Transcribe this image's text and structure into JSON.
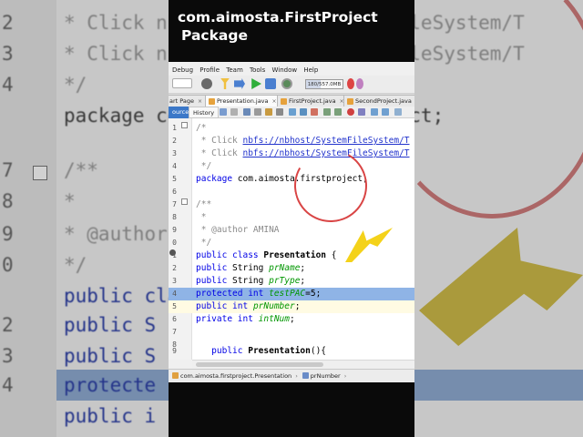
{
  "caption": {
    "line1": "com.aimosta.FirstProject",
    "line2": "Package"
  },
  "background": {
    "lines": [
      {
        "num": "2",
        "text": " * Click nbfs://nbhost/SystemFileSystem/T",
        "style": "cmt"
      },
      {
        "num": "3",
        "text": " * Click nbfs://nbhost/SystemFileSystem/T",
        "style": "cmt"
      },
      {
        "num": "4",
        "text": " */",
        "style": "cmt"
      },
      {
        "num": "",
        "text": "package com.aimosta.firstproject;",
        "style": "plain"
      },
      {
        "num": "7",
        "text": "/**",
        "style": "cmt"
      },
      {
        "num": "8",
        "text": " *",
        "style": "cmt"
      },
      {
        "num": "9",
        "text": " * @author",
        "style": "cmt"
      },
      {
        "num": "0",
        "text": " */",
        "style": "cmt"
      },
      {
        "num": "",
        "text": "public class P",
        "style": "kw"
      },
      {
        "num": "2",
        "text": "public S",
        "style": "kw"
      },
      {
        "num": "3",
        "text": "public S",
        "style": "kw"
      },
      {
        "num": "4",
        "text": "protecte",
        "style": "kw"
      },
      {
        "num": "",
        "text": "public i",
        "style": "kw"
      }
    ]
  },
  "menu": {
    "items": [
      "Debug",
      "Profile",
      "Team",
      "Tools",
      "Window",
      "Help"
    ]
  },
  "toolbar": {
    "memory": "180/557.0MB"
  },
  "tabs": [
    {
      "label": "art Page",
      "close": "×"
    },
    {
      "label": "Presentation.java",
      "close": "×"
    },
    {
      "label": "FirstProject.java",
      "close": "×"
    },
    {
      "label": "SecondProject.java",
      "close": "×"
    }
  ],
  "editor_tabs": {
    "source": "ource",
    "history": "History"
  },
  "code": [
    {
      "n": "1",
      "parts": [
        {
          "t": "/*",
          "c": "cm"
        }
      ]
    },
    {
      "n": "2",
      "parts": [
        {
          "t": " * Click ",
          "c": "cm"
        },
        {
          "t": "nbfs://nbhost/SystemFileSystem/T",
          "c": "lnk"
        }
      ]
    },
    {
      "n": "3",
      "parts": [
        {
          "t": " * Click ",
          "c": "cm"
        },
        {
          "t": "nbfs://nbhost/SystemFileSystem/T",
          "c": "lnk"
        }
      ]
    },
    {
      "n": "4",
      "parts": [
        {
          "t": " */",
          "c": "cm"
        }
      ]
    },
    {
      "n": "5",
      "parts": [
        {
          "t": "package",
          "c": "kw"
        },
        {
          "t": " com.aimosta.firstproject;",
          "c": ""
        }
      ]
    },
    {
      "n": "6",
      "parts": []
    },
    {
      "n": "7",
      "parts": [
        {
          "t": "/**",
          "c": "cm"
        }
      ]
    },
    {
      "n": "8",
      "parts": [
        {
          "t": " *",
          "c": "cm"
        }
      ]
    },
    {
      "n": "9",
      "parts": [
        {
          "t": " * @author AMINA",
          "c": "cm"
        }
      ]
    },
    {
      "n": "0",
      "parts": [
        {
          "t": " */",
          "c": "cm"
        }
      ]
    },
    {
      "n": "1",
      "parts": [
        {
          "t": "public class",
          "c": "kw"
        },
        {
          "t": " ",
          "c": ""
        },
        {
          "t": "Presentation",
          "c": "bold"
        },
        {
          "t": " {",
          "c": ""
        }
      ]
    },
    {
      "n": "2",
      "parts": [
        {
          "t": "public",
          "c": "kw"
        },
        {
          "t": " String ",
          "c": ""
        },
        {
          "t": "prName",
          "c": "fld"
        },
        {
          "t": ";",
          "c": ""
        }
      ]
    },
    {
      "n": "3",
      "parts": [
        {
          "t": "public",
          "c": "kw"
        },
        {
          "t": " String ",
          "c": ""
        },
        {
          "t": "prType",
          "c": "fld"
        },
        {
          "t": ";",
          "c": ""
        }
      ]
    },
    {
      "n": "4",
      "parts": [
        {
          "t": "protected int",
          "c": "kw"
        },
        {
          "t": " ",
          "c": ""
        },
        {
          "t": "testPAC",
          "c": "fld"
        },
        {
          "t": "=5;",
          "c": ""
        }
      ]
    },
    {
      "n": "5",
      "parts": [
        {
          "t": "public int",
          "c": "kw"
        },
        {
          "t": " ",
          "c": ""
        },
        {
          "t": "prNumber",
          "c": "fld"
        },
        {
          "t": ";",
          "c": ""
        }
      ]
    },
    {
      "n": "6",
      "parts": [
        {
          "t": "private int",
          "c": "kw"
        },
        {
          "t": " ",
          "c": ""
        },
        {
          "t": "intNum",
          "c": "fld"
        },
        {
          "t": ";",
          "c": ""
        }
      ]
    },
    {
      "n": "7",
      "parts": []
    },
    {
      "n": "8",
      "parts": []
    },
    {
      "n": "9",
      "parts": [
        {
          "t": "   public",
          "c": "kw"
        },
        {
          "t": " ",
          "c": ""
        },
        {
          "t": "Presentation",
          "c": "bold"
        },
        {
          "t": "(){",
          "c": ""
        }
      ]
    }
  ],
  "status": {
    "crumb1": "com.aimosta.firstproject.Presentation",
    "crumb2": "prNumber"
  }
}
